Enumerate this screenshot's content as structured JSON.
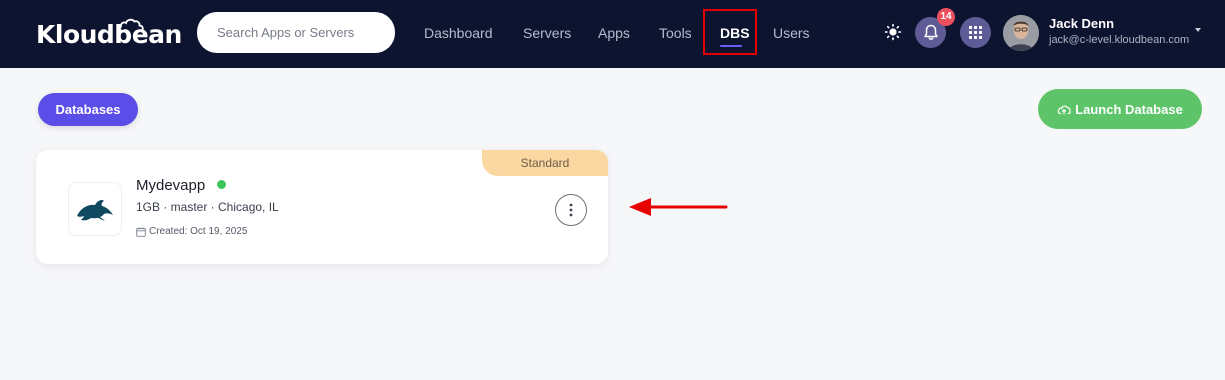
{
  "brand": {
    "logo_text": "Kloudbean"
  },
  "search": {
    "placeholder": "Search Apps or Servers"
  },
  "nav": {
    "items": [
      {
        "label": "Dashboard"
      },
      {
        "label": "Servers"
      },
      {
        "label": "Apps"
      },
      {
        "label": "Tools"
      },
      {
        "label": "DBS",
        "active": true
      },
      {
        "label": "Users"
      }
    ]
  },
  "header": {
    "notifications_count": "14",
    "icons": [
      "sun-icon",
      "bell-icon",
      "grid-apps-icon",
      "chevron-down-icon"
    ]
  },
  "user": {
    "name": "Jack Denn",
    "email": "jack@c-level.kloudbean.com"
  },
  "page": {
    "tab_label": "Databases",
    "launch_label": "Launch Database"
  },
  "database": {
    "plan": "Standard",
    "name": "Mydevapp",
    "status": "online",
    "meta": "1GB · master · Chicago, IL",
    "created": "Created: Oct 19, 2025",
    "engine_icon": "mysql-dolphin-icon"
  },
  "colors": {
    "topbar": "#0d1430",
    "accent": "#5b4de8",
    "launch": "#5dc46a",
    "plan_tag": "#fbd8a2",
    "status_online": "#3cc55a",
    "badge": "#ee4f5c",
    "annotation_red": "#e60000"
  }
}
